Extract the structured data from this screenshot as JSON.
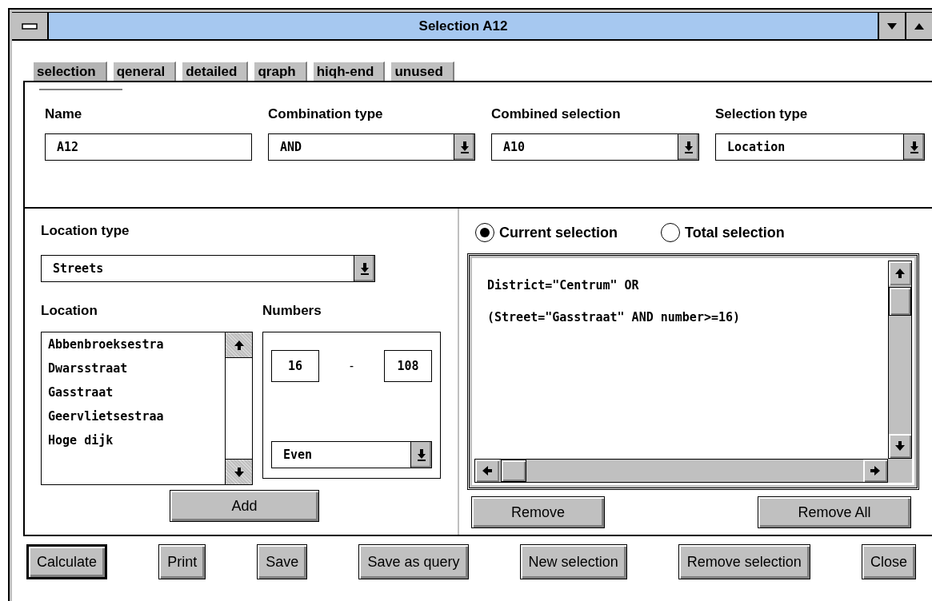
{
  "window": {
    "title": "Selection A12"
  },
  "tabs": [
    {
      "label": "selection",
      "selected": true
    },
    {
      "label": "qeneral",
      "selected": false
    },
    {
      "label": "detailed",
      "selected": false
    },
    {
      "label": "qraph",
      "selected": false
    },
    {
      "label": "hiqh-end",
      "selected": false
    },
    {
      "label": "unused",
      "selected": false
    }
  ],
  "header_fields": [
    {
      "label": "Name",
      "kind": "text",
      "value": "A12"
    },
    {
      "label": "Combination type",
      "kind": "dropdown",
      "value": "AND"
    },
    {
      "label": "Combined selection",
      "kind": "dropdown",
      "value": "A10"
    },
    {
      "label": "Selection type",
      "kind": "dropdown",
      "value": "Location"
    }
  ],
  "location_type": {
    "label": "Location type",
    "value": "Streets"
  },
  "location": {
    "label": "Location",
    "items": [
      "Abbenbroeksestra",
      "Dwarsstraat",
      "Gasstraat",
      "Geervlietsestraa",
      "Hoge dijk"
    ]
  },
  "numbers": {
    "label": "Numbers",
    "from": "16",
    "separator": "-",
    "to": "108",
    "parity": "Even"
  },
  "add_button": {
    "label": "Add"
  },
  "scope": [
    {
      "label": "Current selection",
      "selected": true
    },
    {
      "label": "Total selection",
      "selected": false
    }
  ],
  "query_lines": [
    "District=\"Centrum\" OR",
    "(Street=\"Gasstraat\" AND number>=16)"
  ],
  "query_buttons": [
    {
      "label": "Remove"
    },
    {
      "label": "Remove All"
    }
  ],
  "buttons": [
    {
      "label": "Calculate",
      "default": true
    },
    {
      "label": "Print",
      "default": false
    },
    {
      "label": "Save",
      "default": false
    },
    {
      "label": "Save as query",
      "default": false
    },
    {
      "label": "New selection",
      "default": false
    },
    {
      "label": "Remove selection",
      "default": false
    },
    {
      "label": "Close",
      "default": false
    }
  ]
}
